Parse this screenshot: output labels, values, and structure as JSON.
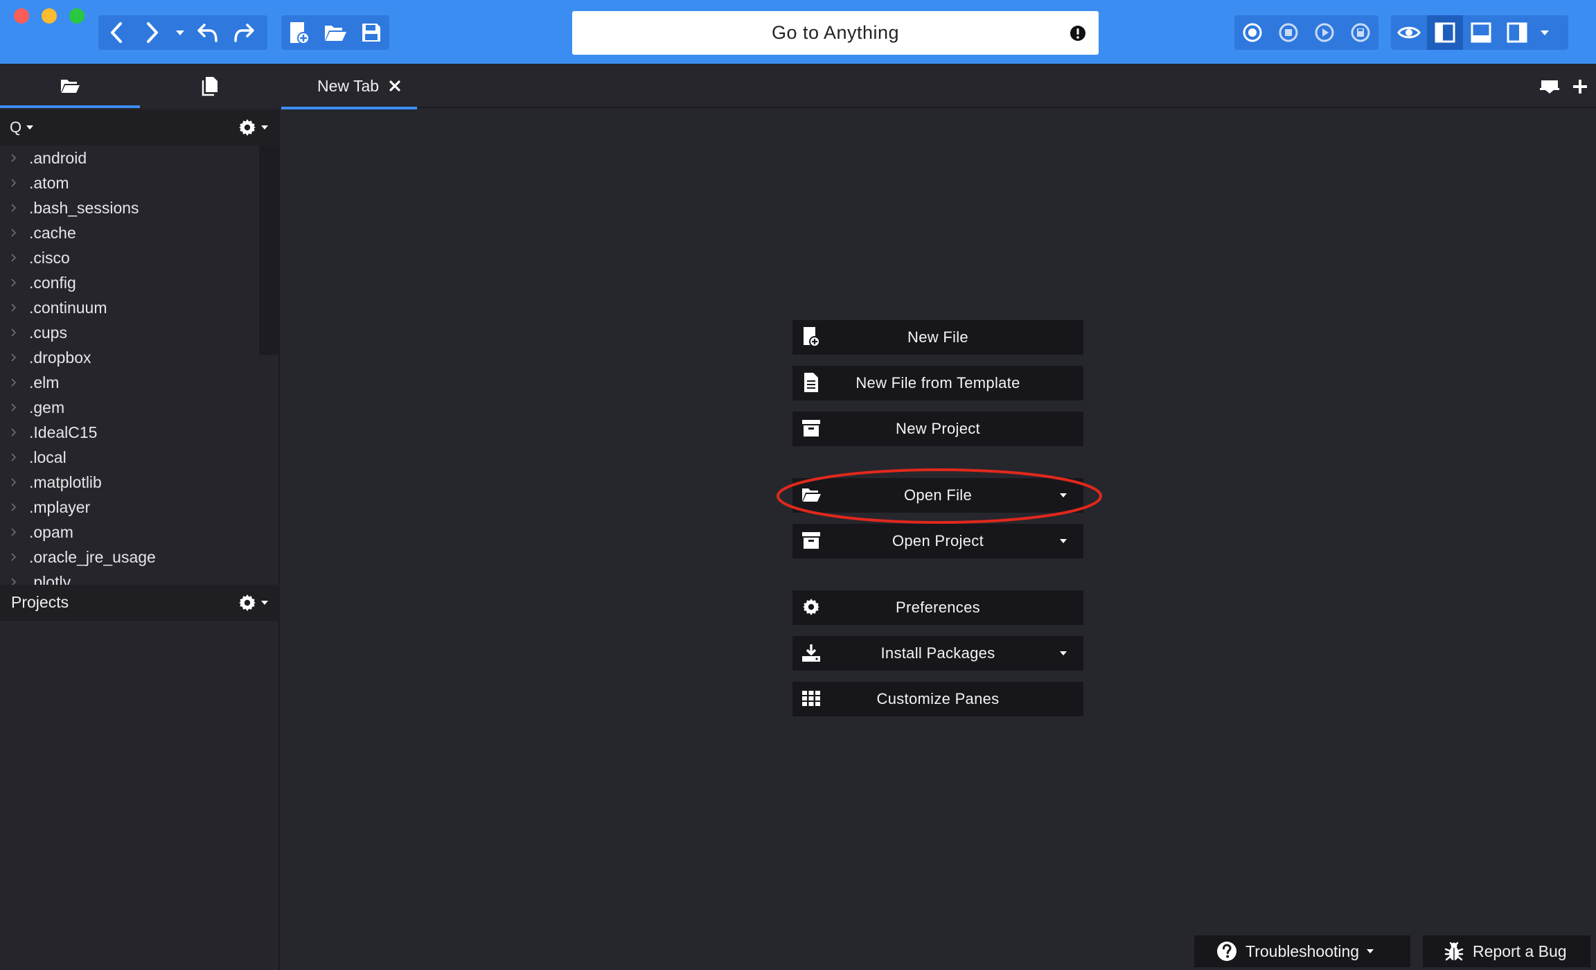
{
  "toolbar": {
    "window_controls": [
      "close",
      "minimize",
      "zoom"
    ],
    "nav_icons": [
      "back-icon",
      "forward-icon",
      "history-dropdown-icon",
      "undo-icon",
      "redo-icon"
    ],
    "file_icons": [
      "new-file-icon",
      "open-folder-icon",
      "save-icon"
    ],
    "goto": {
      "label": "Go to Anything",
      "alert_icon": "exclamation-icon"
    },
    "macro_icons": [
      "record-macro-icon",
      "stop-macro-icon",
      "play-macro-icon",
      "save-macro-icon"
    ],
    "view_icons": [
      "eye-icon",
      "left-pane-icon",
      "bottom-pane-icon",
      "right-pane-icon",
      "pane-dropdown-icon"
    ]
  },
  "sidebar": {
    "tabs": [
      "places-folder-icon",
      "open-files-icon"
    ],
    "filter_label": "Q",
    "tree": [
      ".android",
      ".atom",
      ".bash_sessions",
      ".cache",
      ".cisco",
      ".config",
      ".continuum",
      ".cups",
      ".dropbox",
      ".elm",
      ".gem",
      ".IdealC15",
      ".local",
      ".matplotlib",
      ".mplayer",
      ".opam",
      ".oracle_jre_usage",
      ".plotly"
    ],
    "projects_label": "Projects"
  },
  "editor": {
    "tab": {
      "label": "New Tab"
    },
    "right_icons": [
      "tab-list-icon",
      "new-tab-plus-icon"
    ]
  },
  "start_page": {
    "buttons": [
      {
        "label": "New File",
        "icon": "new-file-icon",
        "dropdown": false
      },
      {
        "label": "New File from Template",
        "icon": "file-text-icon",
        "dropdown": false
      },
      {
        "label": "New Project",
        "icon": "project-box-icon",
        "dropdown": false
      },
      {
        "label": "Open File",
        "icon": "folder-open-icon",
        "dropdown": true
      },
      {
        "label": "Open Project",
        "icon": "project-box-icon",
        "dropdown": true
      },
      {
        "label": "Preferences",
        "icon": "gear-icon",
        "dropdown": false
      },
      {
        "label": "Install Packages",
        "icon": "download-icon",
        "dropdown": true
      },
      {
        "label": "Customize Panes",
        "icon": "grid-icon",
        "dropdown": false
      }
    ],
    "highlight": {
      "target": "Open File",
      "color": "#e0281c"
    }
  },
  "footer": {
    "troubleshooting": "Troubleshooting",
    "report_bug": "Report a Bug"
  },
  "colors": {
    "accent": "#3c8df2",
    "background": "#26262d",
    "button_bg": "#17171b",
    "annotation": "#e0281c"
  }
}
